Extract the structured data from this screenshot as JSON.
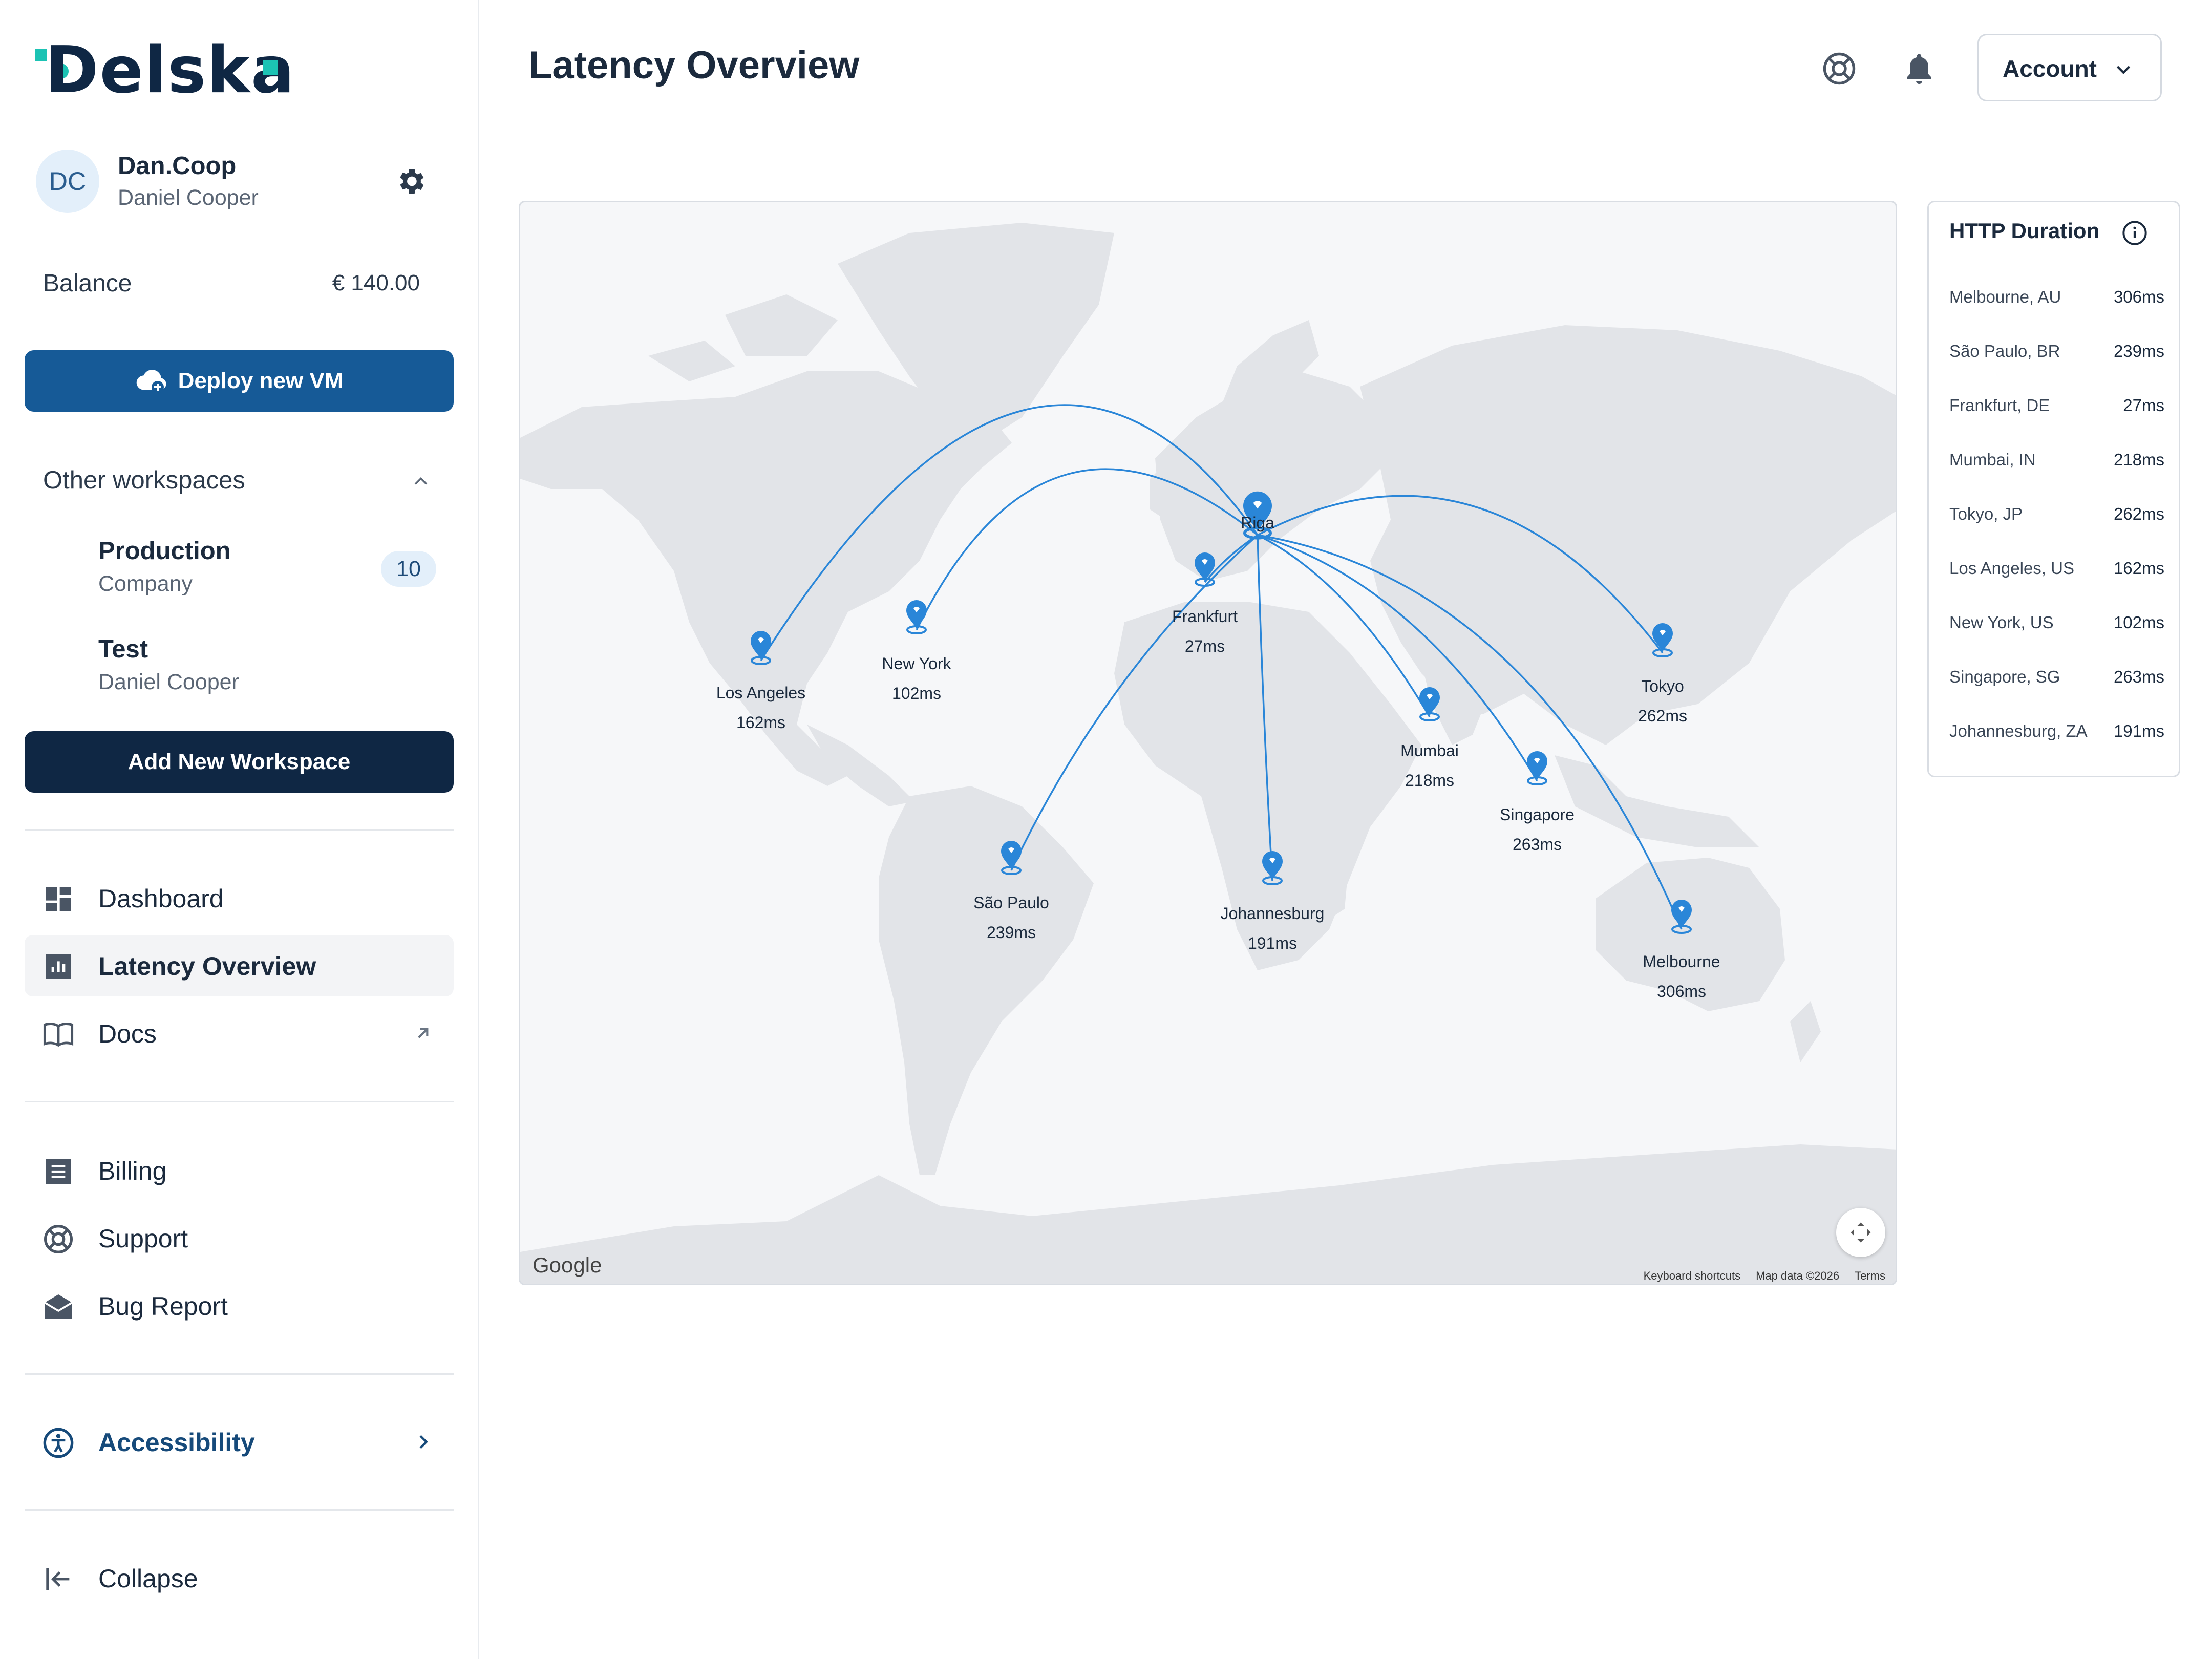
{
  "brand": {
    "logo_text": "Delska"
  },
  "user": {
    "initials": "DC",
    "username": "Dan.Coop",
    "full_name": "Daniel Cooper"
  },
  "balance": {
    "label": "Balance",
    "value": "€ 140.00"
  },
  "deploy_button": "Deploy new VM",
  "workspaces": {
    "title": "Other workspaces",
    "items": [
      {
        "name": "Production",
        "subtitle": "Company",
        "badge": "10"
      },
      {
        "name": "Test",
        "subtitle": "Daniel Cooper"
      }
    ],
    "add_button": "Add New Workspace"
  },
  "nav": {
    "main": [
      {
        "label": "Dashboard",
        "icon": "dashboard-icon"
      },
      {
        "label": "Latency Overview",
        "icon": "bar-chart-icon",
        "active": true
      },
      {
        "label": "Docs",
        "icon": "book-icon",
        "external": true
      }
    ],
    "secondary": [
      {
        "label": "Billing",
        "icon": "receipt-icon"
      },
      {
        "label": "Support",
        "icon": "lifebuoy-icon"
      },
      {
        "label": "Bug Report",
        "icon": "mail-icon"
      }
    ],
    "accessibility": "Accessibility",
    "collapse": "Collapse"
  },
  "header": {
    "title": "Latency Overview",
    "account_label": "Account"
  },
  "map": {
    "google_label": "Google",
    "attribution": [
      "Keyboard shortcuts",
      "Map data ©2026",
      "Terms"
    ],
    "origin": {
      "name": "Riga"
    },
    "pins": [
      {
        "name": "Los Angeles",
        "latency": "162ms"
      },
      {
        "name": "New York",
        "latency": "102ms"
      },
      {
        "name": "Frankfurt",
        "latency": "27ms"
      },
      {
        "name": "Tokyo",
        "latency": "262ms"
      },
      {
        "name": "Mumbai",
        "latency": "218ms"
      },
      {
        "name": "Singapore",
        "latency": "263ms"
      },
      {
        "name": "São Paulo",
        "latency": "239ms"
      },
      {
        "name": "Johannesburg",
        "latency": "191ms"
      },
      {
        "name": "Melbourne",
        "latency": "306ms"
      }
    ],
    "colors": {
      "route": "#2a86d8",
      "pin": "#2a86d8",
      "land": "#e2e4e8",
      "water": "#f6f7f9"
    }
  },
  "http_duration": {
    "title": "HTTP Duration",
    "rows": [
      {
        "location": "Melbourne, AU",
        "value": "306ms"
      },
      {
        "location": "São Paulo, BR",
        "value": "239ms"
      },
      {
        "location": "Frankfurt, DE",
        "value": "27ms"
      },
      {
        "location": "Mumbai, IN",
        "value": "218ms"
      },
      {
        "location": "Tokyo, JP",
        "value": "262ms"
      },
      {
        "location": "Los Angeles, US",
        "value": "162ms"
      },
      {
        "location": "New York, US",
        "value": "102ms"
      },
      {
        "location": "Singapore, SG",
        "value": "263ms"
      },
      {
        "location": "Johannesburg, ZA",
        "value": "191ms"
      }
    ]
  },
  "colors": {
    "primary": "#165a97",
    "navy": "#0f2744",
    "accent": "#1cc3b4"
  }
}
